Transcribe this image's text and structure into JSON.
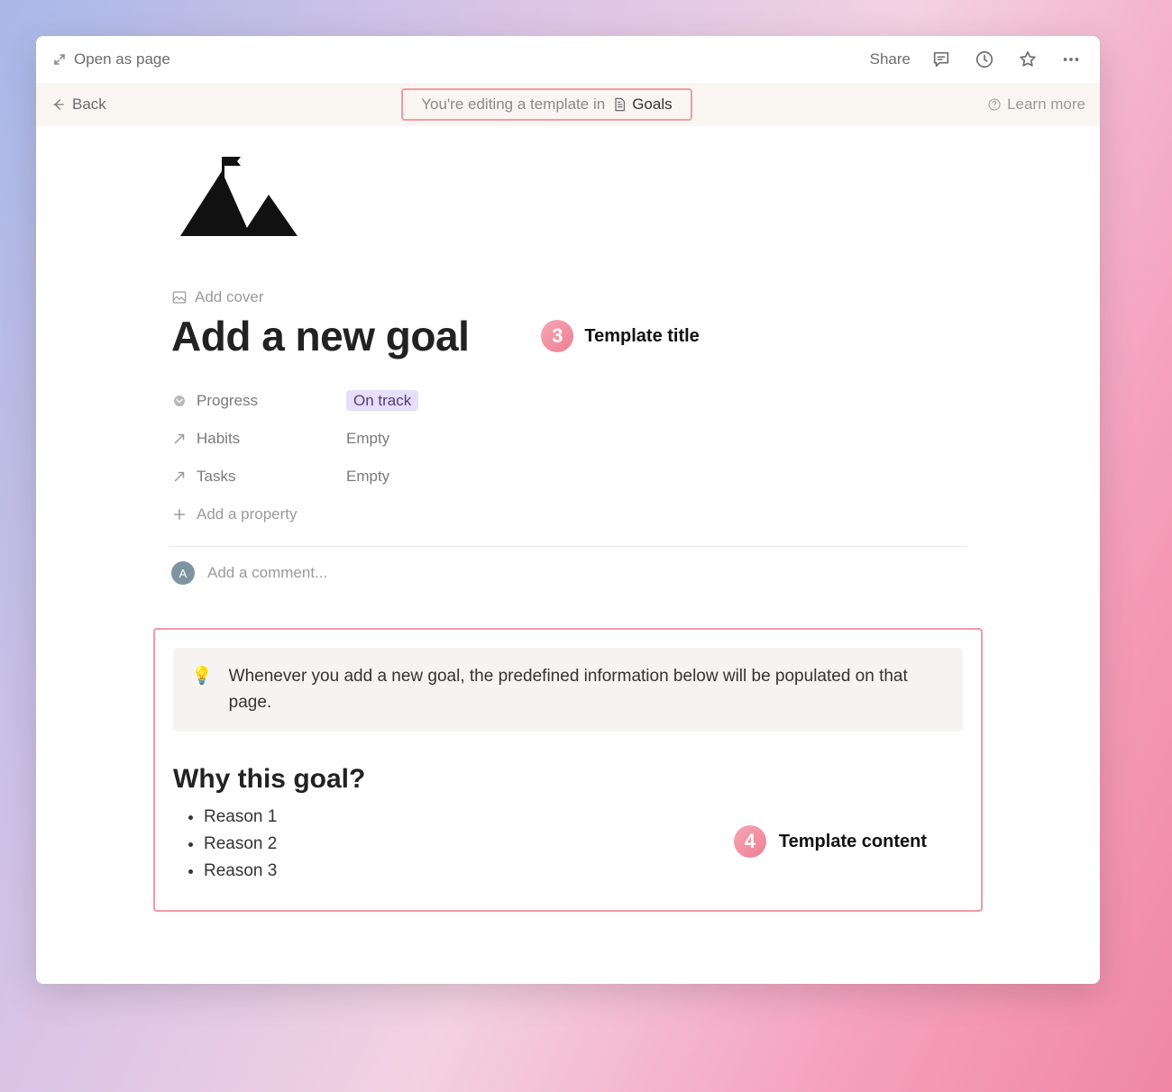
{
  "topbar": {
    "open_as_page": "Open as page",
    "share": "Share"
  },
  "banner": {
    "back": "Back",
    "editing_text": "You're editing a template in",
    "db_name": "Goals",
    "learn_more": "Learn more"
  },
  "page": {
    "add_cover": "Add cover",
    "title": "Add a new goal"
  },
  "annotations": {
    "three_num": "3",
    "three_label": "Template title",
    "four_num": "4",
    "four_label": "Template content"
  },
  "properties": {
    "progress": {
      "label": "Progress",
      "value": "On track"
    },
    "habits": {
      "label": "Habits",
      "value": "Empty"
    },
    "tasks": {
      "label": "Tasks",
      "value": "Empty"
    },
    "add_property": "Add a property"
  },
  "comment": {
    "avatar_initial": "A",
    "placeholder": "Add a comment..."
  },
  "callout": {
    "text": "Whenever you add a new goal, the predefined information below will be populated on that page."
  },
  "section": {
    "heading": "Why this goal?",
    "reasons": [
      "Reason 1",
      "Reason 2",
      "Reason 3"
    ]
  }
}
